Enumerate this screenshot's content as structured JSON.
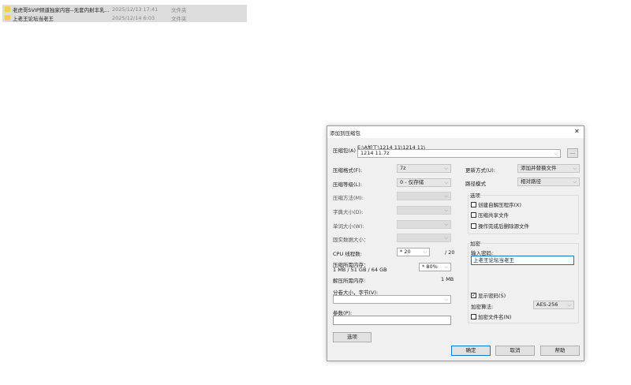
{
  "files": [
    {
      "name": "老虎哥SVIP频道独家内容--无套内射丰乳...",
      "date": "2025/12/13 17:41",
      "type": "文件夹"
    },
    {
      "name": "上老王论坛当老王",
      "date": "2025/12/14 6:03",
      "type": "文件夹"
    }
  ],
  "dialog": {
    "title": "添加到压缩包",
    "close": "✕",
    "archive_label": "压缩包(A)",
    "archive_path": "E:\\A加工\\1214 11\\1214 11\\",
    "archive_name": "1214 11.7z",
    "browse": "...",
    "left": {
      "format_label": "压缩格式(F):",
      "format": "7z",
      "level_label": "压缩等级(L):",
      "level": "0 - 仅存储",
      "method_label": "压缩方法(M):",
      "dict_label": "字典大小(D):",
      "word_label": "单词大小(W):",
      "solid_label": "固实数据大小：",
      "cpu_label": "CPU 线程数:",
      "cpu": "* 20",
      "cpu_max": "/ 20",
      "mem_label": "压缩所需内存：",
      "mem_detail": "1 MB / 51 GB / 64 GB",
      "mem_pct": "* 80%",
      "dmem_label": "解压所需内存:",
      "dmem": "1 MB",
      "volume_label": "分卷大小，字节(V):",
      "volume": "",
      "params_label": "参数(P):",
      "params": "",
      "options_button": "选项"
    },
    "right": {
      "update_label": "更新方式(U):",
      "update": "添加并替换文件",
      "path_label": "路径模式",
      "path": "相对路径",
      "options_group": "选项",
      "opt_sfx": "创建自解压程序(X)",
      "opt_shared": "压缩共享文件",
      "opt_delete": "操作完成后删除源文件",
      "enc_group": "加密",
      "pwd_label": "输入密码:",
      "pwd": "上老王论坛当老王",
      "show_pwd": "显示密码(S)",
      "show_pwd_checked": true,
      "alg_label": "加密算法:",
      "alg": "AES-256",
      "enc_names": "加密文件名(N)"
    },
    "ok": "确定",
    "cancel": "取消",
    "help": "帮助",
    "chevron": "⌵"
  }
}
